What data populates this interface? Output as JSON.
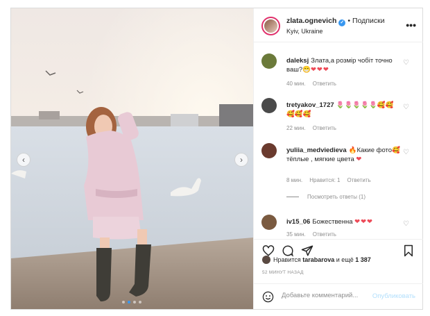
{
  "post": {
    "photo_alt": "",
    "nav_prev": "‹",
    "nav_next": "›"
  },
  "header": {
    "username": "zlata.ognevich",
    "verified_mark": "✓",
    "separator": "•",
    "follow_label": "Подписки",
    "location": "Kyiv, Ukraine",
    "more": "•••"
  },
  "comments": [
    {
      "user": "daleksj",
      "text": "Злата,а розмір чобіт точно ваш?😁",
      "hearts": "❤❤❤",
      "time": "40 мин.",
      "reply": "Ответить",
      "likes": ""
    },
    {
      "user": "tretyakov_1727",
      "text": "🌷🌷🌷🌷🌷🥰🥰🥰🥰🥰",
      "hearts": "",
      "time": "22 мин.",
      "reply": "Ответить",
      "likes": ""
    },
    {
      "user": "yuliia_medviedieva",
      "text": "🔥Какие фото🥰тёплые , мягкие цвета",
      "hearts": "❤",
      "time": "8 мин.",
      "reply": "Ответить",
      "likes": "Нравится: 1"
    },
    {
      "user": "iv15_06",
      "text": "Божественна",
      "hearts": "❤❤❤",
      "time": "35 мин.",
      "reply": "Ответить",
      "likes": ""
    }
  ],
  "replies_label": "Посмотреть ответы (1)",
  "likes": {
    "prefix": "Нравится",
    "user": "tarabarova",
    "middle": "и ещё",
    "count": "1 387"
  },
  "time_ago": "52 МИНУТ НАЗАД",
  "add_comment": {
    "placeholder": "Добавьте комментарий...",
    "publish": "Опубликовать"
  },
  "icons": [
    "heart-icon",
    "comment-icon",
    "share-icon",
    "bookmark-icon",
    "emoji-icon",
    "more-icon"
  ],
  "colors": {
    "verified": "#3897f0",
    "heart": "#ed4956",
    "publish_disabled": "#b2dffc",
    "muted": "#8e8e8e"
  }
}
